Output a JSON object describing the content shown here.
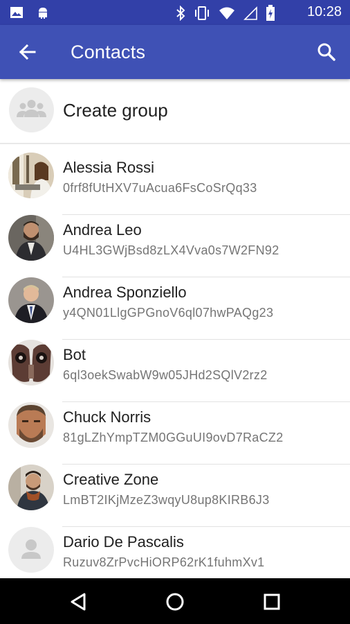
{
  "status_bar": {
    "time": "10:28",
    "icons": [
      "image-icon",
      "android-icon",
      "bluetooth-icon",
      "vibrate-icon",
      "wifi-icon",
      "signal-icon",
      "battery-icon"
    ]
  },
  "app_bar": {
    "title": "Contacts",
    "back_icon": "arrow-back-icon",
    "search_icon": "search-icon",
    "color": "#3f51b5",
    "status_color": "#3240a8"
  },
  "create_group": {
    "label": "Create group",
    "icon": "group-icon"
  },
  "contacts": [
    {
      "name": "Alessia Rossi",
      "id": "0frf8fUtHXV7uAcua6FsCoSrQq33"
    },
    {
      "name": "Andrea Leo",
      "id": "U4HL3GWjBsd8zLX4Vva0s7W2FN92"
    },
    {
      "name": "Andrea Sponziello",
      "id": "y4QN01LlgGPGnoV6ql07hwPAQg23"
    },
    {
      "name": "Bot",
      "id": "6ql3oekSwabW9w05JHd2SQlV2rz2"
    },
    {
      "name": "Chuck Norris",
      "id": "81gLZhYmpTZM0GGuUI9ovD7RaCZ2"
    },
    {
      "name": "Creative Zone",
      "id": "LmBT2IKjMzeZ3wqyU8up8KIRB6J3"
    },
    {
      "name": "Dario De Pascalis",
      "id": "Ruzuv8ZrPvcHiORP62rK1fuhmXv1"
    }
  ],
  "nav_bar": {
    "icons": [
      "back-triangle-icon",
      "home-circle-icon",
      "recents-square-icon"
    ]
  }
}
